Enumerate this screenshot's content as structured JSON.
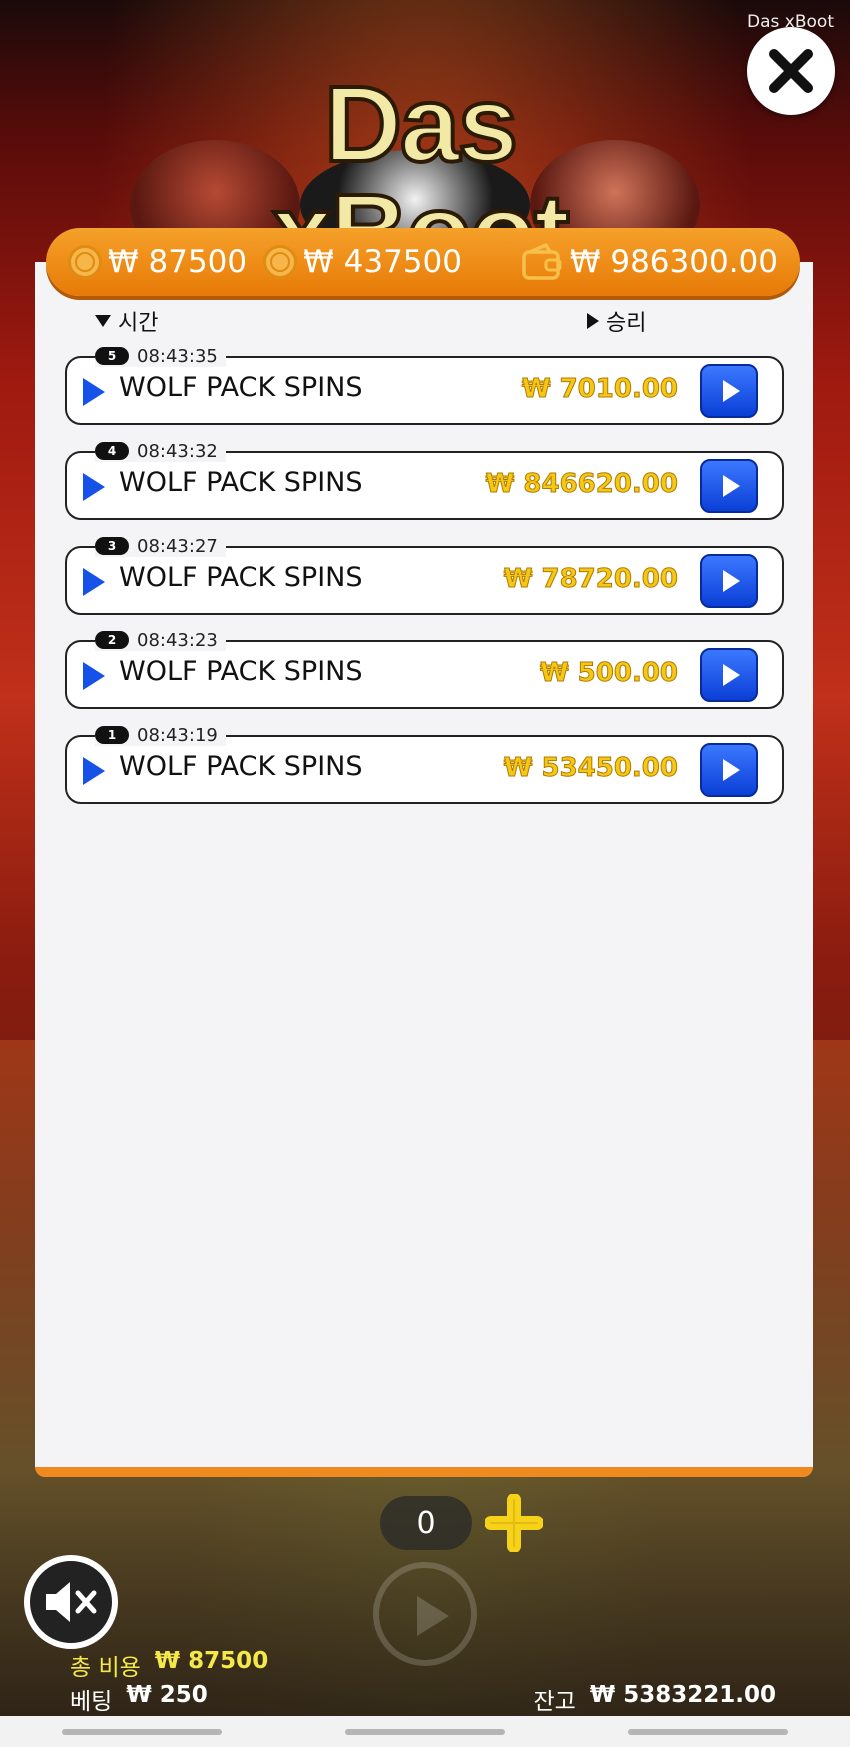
{
  "window": {
    "game_name": "Das xBoot"
  },
  "logo": {
    "text": "Das xBoot"
  },
  "stats": {
    "cost_1": "₩ 87500",
    "cost_2": "₩ 437500",
    "balance_total": "₩ 986300.00"
  },
  "history": {
    "col_time": "시간",
    "col_win": "승리",
    "rows": [
      {
        "index": "5",
        "time": "08:43:35",
        "name": "WOLF PACK SPINS",
        "win": "₩ 7010.00"
      },
      {
        "index": "4",
        "time": "08:43:32",
        "name": "WOLF PACK SPINS",
        "win": "₩ 846620.00"
      },
      {
        "index": "3",
        "time": "08:43:27",
        "name": "WOLF PACK SPINS",
        "win": "₩ 78720.00"
      },
      {
        "index": "2",
        "time": "08:43:23",
        "name": "WOLF PACK SPINS",
        "win": "₩ 500.00"
      },
      {
        "index": "1",
        "time": "08:43:19",
        "name": "WOLF PACK SPINS",
        "win": "₩ 53450.00"
      }
    ]
  },
  "controls": {
    "counter": "0"
  },
  "footer": {
    "total_cost_label": "총 비용",
    "total_cost_value": "₩ 87500",
    "bet_label": "베팅",
    "bet_value": "₩ 250",
    "balance_label": "잔고",
    "balance_value": "₩ 5383221.00"
  },
  "colors": {
    "accent": "#ef8a1e",
    "replay": "#1652e8",
    "win": "#f5c816"
  },
  "icons": {
    "close": "close-icon",
    "mute": "speaker-mute-icon",
    "plus": "plus-icon",
    "wallet": "wallet-icon",
    "coin": "coin-icon"
  }
}
